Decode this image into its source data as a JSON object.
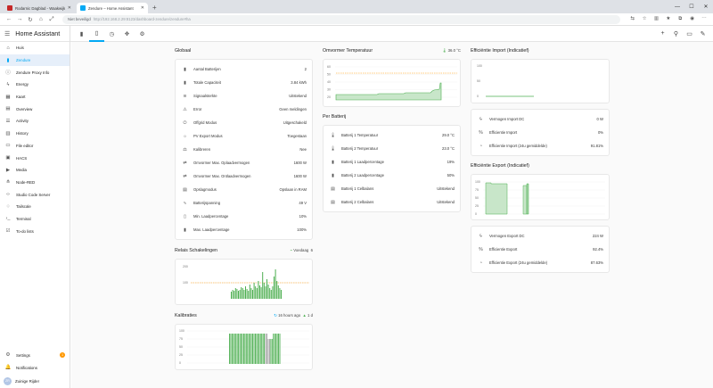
{
  "browser": {
    "tabs": [
      {
        "label": "Rodarnic Dagblad - Waakwijk Ei",
        "color": "#c62828"
      },
      {
        "label": "Zendure – Home Assistant",
        "color": "#03a9f4"
      }
    ],
    "security": "Niet beveiligd",
    "url": "http://192.168.2.29:8123/dashboard-zendure/zendure#ha"
  },
  "sidebar": {
    "title": "Home Assistant",
    "items": [
      {
        "label": "Huis",
        "icon": "home-icon"
      },
      {
        "label": "Zendure",
        "icon": "battery-icon",
        "active": true
      },
      {
        "label": "Zendure Proxy Info",
        "icon": "proxy-icon"
      },
      {
        "label": "Energy",
        "icon": "lightning-icon"
      },
      {
        "label": "Kaart",
        "icon": "map-icon"
      },
      {
        "label": "Overview",
        "icon": "grid-icon"
      },
      {
        "label": "Activity",
        "icon": "list-icon"
      },
      {
        "label": "History",
        "icon": "chart-icon"
      },
      {
        "label": "File editor",
        "icon": "folder-icon"
      },
      {
        "label": "HACS",
        "icon": "store-icon"
      },
      {
        "label": "Media",
        "icon": "media-icon"
      },
      {
        "label": "Node-RED",
        "icon": "sitemap-icon"
      },
      {
        "label": "Studio Code Server",
        "icon": "code-icon"
      },
      {
        "label": "Tailscale",
        "icon": "network-icon"
      },
      {
        "label": "Terminal",
        "icon": "terminal-icon"
      },
      {
        "label": "To-do lists",
        "icon": "todo-icon"
      }
    ],
    "bottom": {
      "settings": "Settings",
      "settings_badge": "1",
      "notifications": "Notifications",
      "user": "Zuinige Rijder",
      "user_initials": "ZR"
    }
  },
  "globaal": {
    "title": "Globaal",
    "rows": [
      {
        "icon": "battery-icon",
        "label": "Aantal Batterijen",
        "value": "2"
      },
      {
        "icon": "battery-icon",
        "label": "Totale Capaciteit",
        "value": "3.84 kWh"
      },
      {
        "icon": "wifi-icon",
        "label": "Signaalsterkte",
        "value": "Uitstekend"
      },
      {
        "icon": "alert-icon",
        "label": "Error",
        "value": "Geen meldingen"
      },
      {
        "icon": "plug-icon",
        "label": "Offgrid Modus",
        "value": "Uitgeschakeld"
      },
      {
        "icon": "solar-icon",
        "label": "PV Export Modus",
        "value": "Toegestaan"
      },
      {
        "icon": "calibrate-icon",
        "label": "Kalibreren",
        "value": "Nee"
      },
      {
        "icon": "inverter-icon",
        "label": "Omvormer Max. Oplaadvermogen",
        "value": "1600 W"
      },
      {
        "icon": "inverter-icon",
        "label": "Omvormer Max. Ontlaadvermogen",
        "value": "1600 W"
      },
      {
        "icon": "storage-icon",
        "label": "Opslagmodus",
        "value": "Opslaan in RAM"
      },
      {
        "icon": "voltage-icon",
        "label": "Batterijspanning",
        "value": "49 V"
      },
      {
        "icon": "battery-low-icon",
        "label": "Min. Laadpercentage",
        "value": "10%"
      },
      {
        "icon": "battery-full-icon",
        "label": "Max. Laadpercentage",
        "value": "100%"
      }
    ]
  },
  "relais": {
    "title": "Relais Schakelingen",
    "badge": "Voedaag",
    "badge_value": "6",
    "yticks": [
      "200",
      "100"
    ]
  },
  "kalibraties": {
    "title": "Kalibraties",
    "ago": "16 hours ago",
    "count": "1 d",
    "yticks": [
      "100",
      "75",
      "50",
      "25",
      "0"
    ]
  },
  "omvormer": {
    "title": "Omvormer Temperatuur",
    "current": "36.0 °C",
    "yticks": [
      "60",
      "50",
      "40",
      "30",
      "20"
    ]
  },
  "per_batterij": {
    "title": "Per Batterij",
    "rows": [
      {
        "icon": "thermometer-icon",
        "label": "Batterij 1 Temperatuur",
        "value": "29.0 °C"
      },
      {
        "icon": "thermometer-icon",
        "label": "Batterij 2 Temperatuur",
        "value": "23.0 °C"
      },
      {
        "icon": "battery-icon",
        "label": "Batterij 1 Laadpercentage",
        "value": "19%"
      },
      {
        "icon": "battery-icon",
        "label": "Batterij 2 Laadpercentage",
        "value": "50%"
      },
      {
        "icon": "battery-cell-icon",
        "label": "Batterij 1 Celbalans",
        "value": "Uitstekend"
      },
      {
        "icon": "battery-cell-icon",
        "label": "Batterij 2 Celbalans",
        "value": "Uitstekend"
      }
    ]
  },
  "efficiency_import": {
    "title": "Efficiëntie Import (Indicatief)",
    "yticks": [
      "100",
      "50",
      "0"
    ],
    "rows": [
      {
        "icon": "lightning-icon",
        "label": "Vermogen Import DC",
        "value": "0 W"
      },
      {
        "icon": "percent-icon",
        "label": "Efficientie Import",
        "value": "0%"
      },
      {
        "icon": "gauge-icon",
        "label": "Efficientie Import (24u gemiddelde)",
        "value": "91.81%"
      }
    ]
  },
  "efficiency_export": {
    "title": "Efficiëntie Export (Indicatief)",
    "yticks": [
      "100",
      "75",
      "50",
      "25",
      "0"
    ],
    "rows": [
      {
        "icon": "lightning-icon",
        "label": "Vermogen Export DC",
        "value": "224 W"
      },
      {
        "icon": "percent-icon",
        "label": "Efficientie Export",
        "value": "92.4%"
      },
      {
        "icon": "gauge-icon",
        "label": "Efficientie Export (24u gemiddelde)",
        "value": "87.63%"
      }
    ]
  },
  "colors": {
    "accent": "#03a9f4",
    "chart": "#4caf50",
    "threshold": "#ff9800"
  }
}
